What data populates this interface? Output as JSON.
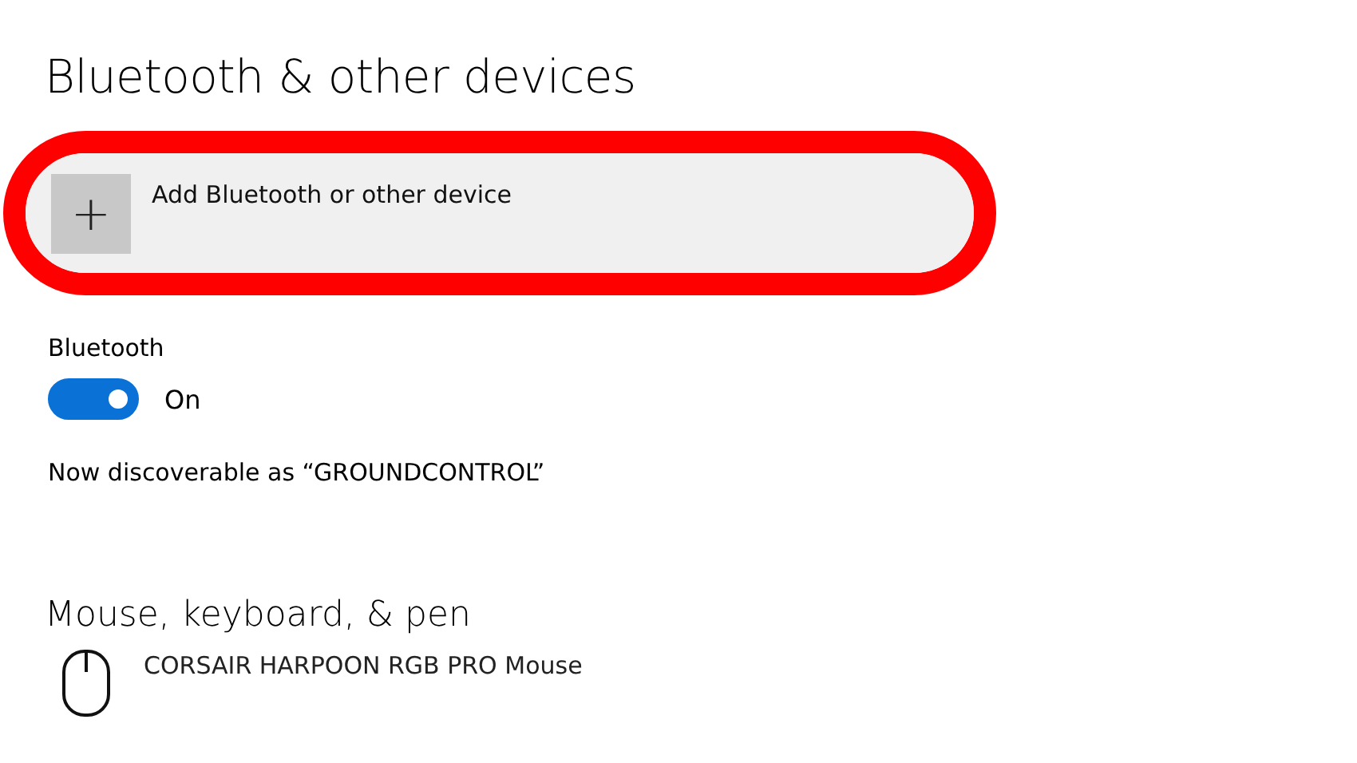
{
  "title": "Bluetooth & other devices",
  "add_button": {
    "label": "Add Bluetooth or other device",
    "icon": "+"
  },
  "bluetooth": {
    "label": "Bluetooth",
    "on": true,
    "state_text": "On"
  },
  "discoverable_text": "Now discoverable as “GROUNDCONTROL”",
  "section": {
    "title": "Mouse, keyboard, & pen",
    "devices": [
      {
        "name": "CORSAIR HARPOON RGB PRO Mouse",
        "kind": "mouse"
      }
    ]
  }
}
